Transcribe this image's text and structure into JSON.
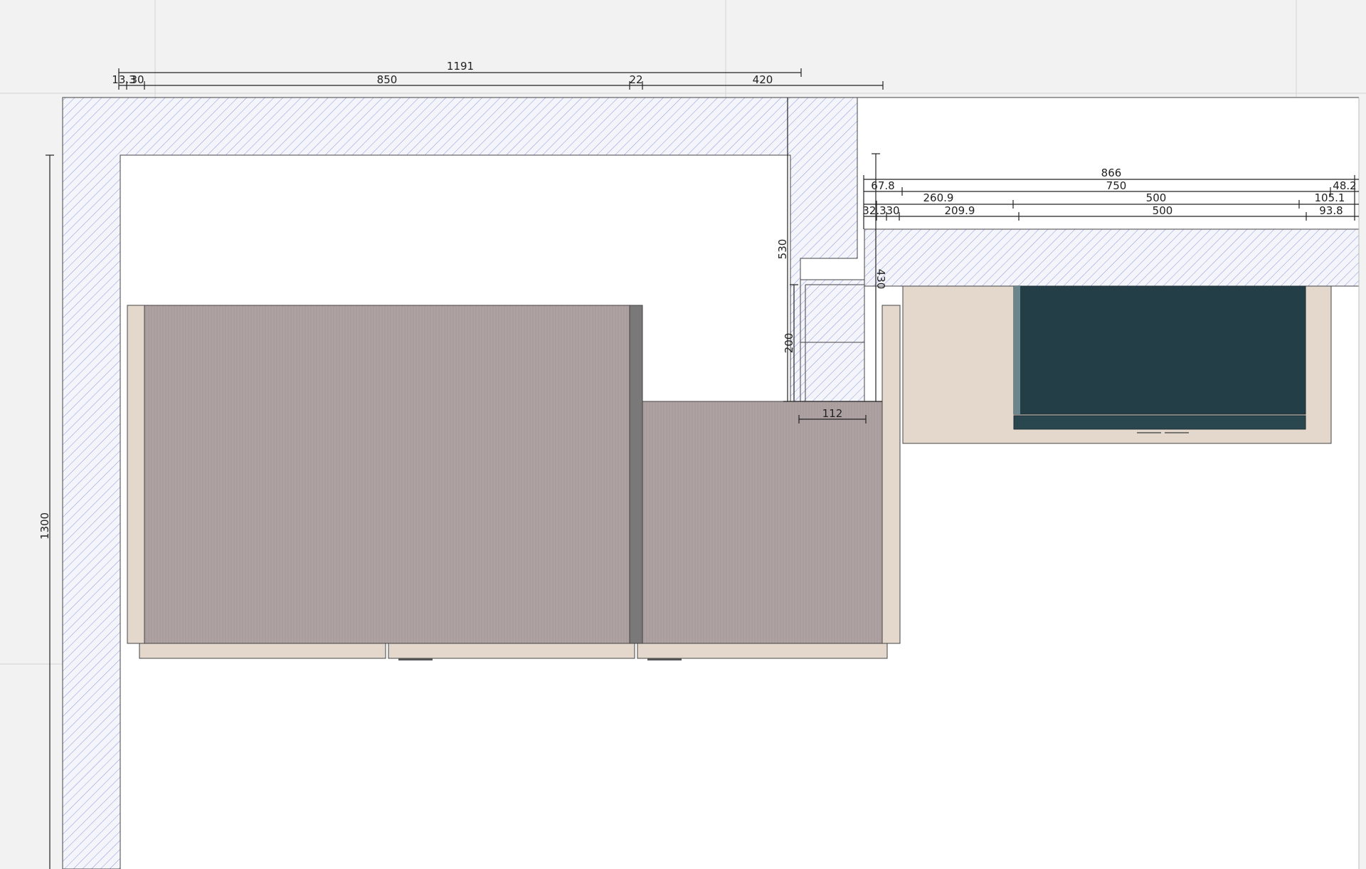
{
  "colors": {
    "background": "#f2f2f2",
    "wall_hatch": "#8a96dc",
    "wall_fill": "#f4f5fb",
    "room_floor": "#ffffff",
    "cabinet_body": "#ada1a1",
    "cabinet_side": "#e3d8cb",
    "cabinet_dark_side": "#7a7878",
    "appliance_dark": "#243e47",
    "dimension_line": "#222222"
  },
  "dimensions": {
    "top_overall": "1191",
    "top_a": "13.3",
    "top_b": "30",
    "top_c": "850",
    "top_d": "22",
    "top_e": "420",
    "right_overall": "866",
    "right_r1_a": "67.8",
    "right_r1_b": "750",
    "right_r1_c": "48.2",
    "right_r2_a": "260.9",
    "right_r2_b": "500",
    "right_r2_c": "105.1",
    "right_r3_a": "32.3",
    "right_r3_b": "30",
    "right_r3_c": "209.9",
    "right_r3_d": "500",
    "right_r3_e": "93.8",
    "left_height": "1300",
    "column_height": "530",
    "column_lower": "200",
    "column_right": "430",
    "column_width": "112"
  }
}
